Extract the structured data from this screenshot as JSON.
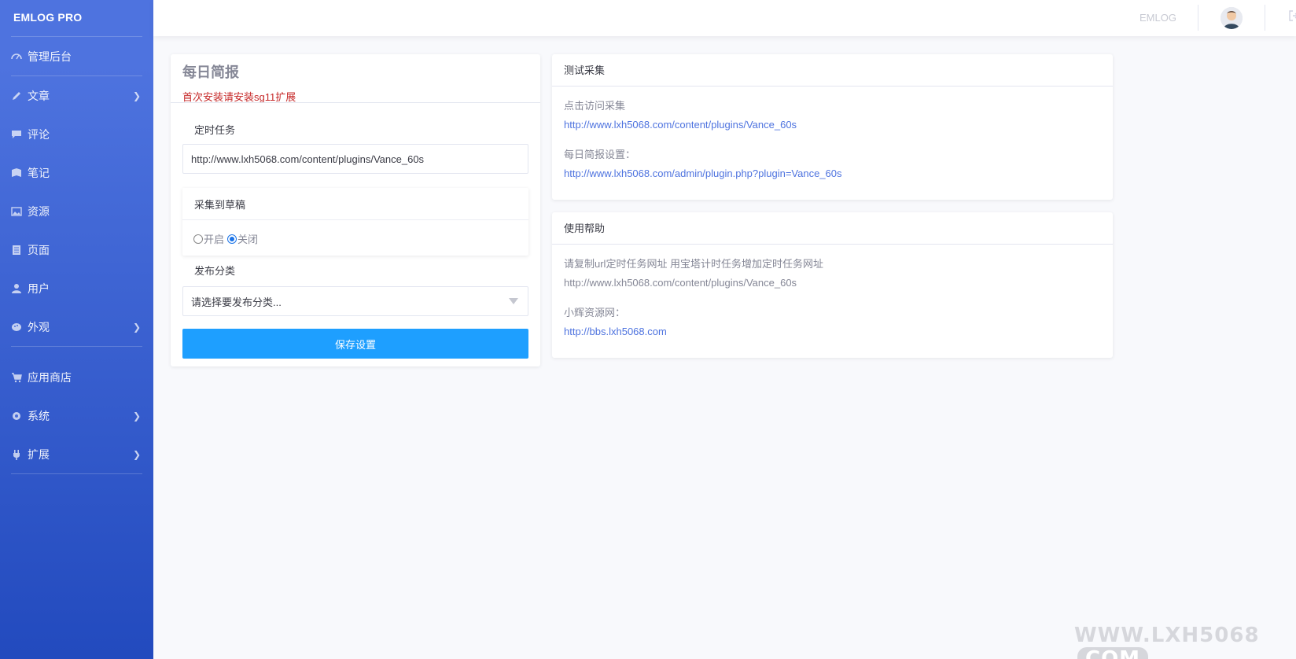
{
  "sidebar": {
    "brand": "EMLOG PRO",
    "items": [
      {
        "label": "管理后台",
        "icon": "dashboard-icon",
        "chevron": false
      },
      {
        "label": "文章",
        "icon": "pencil-icon",
        "chevron": true
      },
      {
        "label": "评论",
        "icon": "comment-icon",
        "chevron": false
      },
      {
        "label": "笔记",
        "icon": "note-icon",
        "chevron": false
      },
      {
        "label": "资源",
        "icon": "image-icon",
        "chevron": false
      },
      {
        "label": "页面",
        "icon": "page-icon",
        "chevron": false
      },
      {
        "label": "用户",
        "icon": "user-icon",
        "chevron": false
      },
      {
        "label": "外观",
        "icon": "palette-icon",
        "chevron": true
      },
      {
        "label": "应用商店",
        "icon": "cart-icon",
        "chevron": false
      },
      {
        "label": "系统",
        "icon": "gear-icon",
        "chevron": true
      },
      {
        "label": "扩展",
        "icon": "plug-icon",
        "chevron": true
      }
    ]
  },
  "topbar": {
    "link": "EMLOG",
    "avatar_icon": "avatar-icon",
    "logout_icon": "logout-icon"
  },
  "left_card": {
    "title": "每日简报",
    "notice": "首次安装请安装sg11扩展",
    "cron_label": "定时任务",
    "cron_value": "http://www.lxh5068.com/content/plugins/Vance_60s",
    "draft_label": "采集到草稿",
    "radio_on": "开启",
    "radio_off": "关闭",
    "category_label": "发布分类",
    "category_placeholder": "请选择要发布分类...",
    "save_label": "保存设置"
  },
  "test_card": {
    "title": "测试采集",
    "visit_label": "点击访问采集",
    "visit_link": "http://www.lxh5068.com/content/plugins/Vance_60s",
    "settings_label": "每日简报设置：",
    "settings_link": "http://www.lxh5068.com/admin/plugin.php?plugin=Vance_60s"
  },
  "help_card": {
    "title": "使用帮助",
    "instruction": "请复制url定时任务网址 用宝塔计时任务增加定时任务网址",
    "cron_link": "http://www.lxh5068.com/content/plugins/Vance_60s",
    "site_label": "小辉资源网：",
    "site_link": "http://bbs.lxh5068.com"
  },
  "watermark": {
    "text": "WWW.LXH5068",
    "suffix": "COM"
  },
  "colors": {
    "sidebar_top": "#4e73df",
    "sidebar_bottom": "#224abe",
    "button": "#1e9fff",
    "notice": "#c62828",
    "link": "#4e73df"
  }
}
